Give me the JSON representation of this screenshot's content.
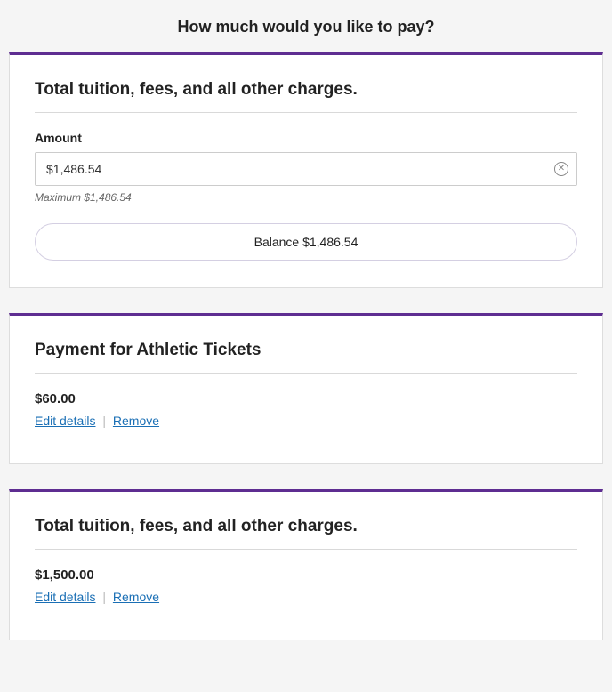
{
  "page_title": "How much would you like to pay?",
  "cards": [
    {
      "title": "Total tuition, fees, and all other charges.",
      "amount_label": "Amount",
      "amount_value": "$1,486.54",
      "hint": "Maximum $1,486.54",
      "balance_button": "Balance $1,486.54"
    },
    {
      "title": "Payment for Athletic Tickets",
      "amount": "$60.00",
      "edit_label": "Edit details",
      "remove_label": "Remove"
    },
    {
      "title": "Total tuition, fees, and all other charges.",
      "amount": "$1,500.00",
      "edit_label": "Edit details",
      "remove_label": "Remove"
    }
  ]
}
